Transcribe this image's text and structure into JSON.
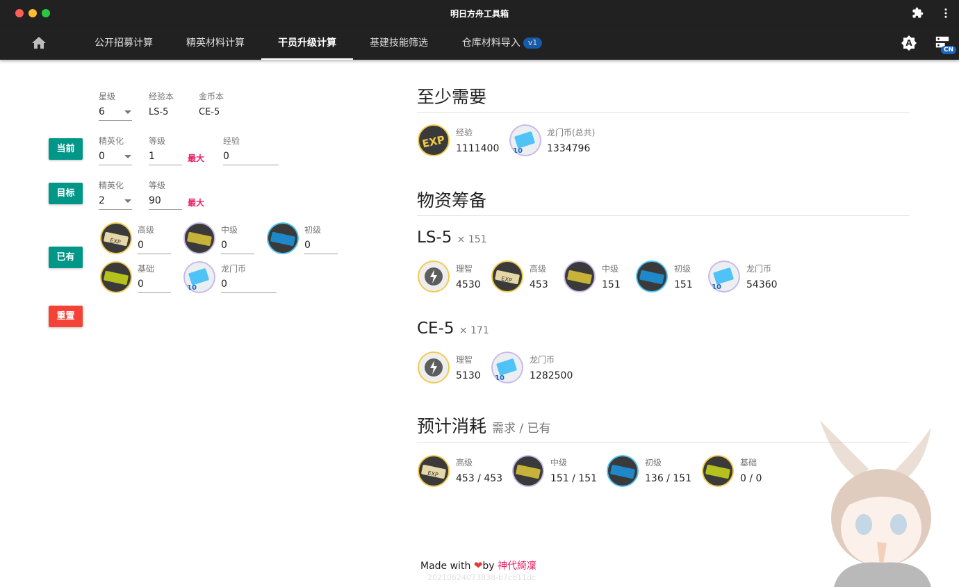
{
  "window": {
    "title": "明日方舟工具箱"
  },
  "nav": {
    "tabs": [
      {
        "label": "公开招募计算"
      },
      {
        "label": "精英材料计算"
      },
      {
        "label": "干员升级计算"
      },
      {
        "label": "基建技能筛选"
      },
      {
        "label": "仓库材料导入",
        "badge": "v1"
      }
    ],
    "active_tab": "干员升级计算",
    "lang_badge": "CN"
  },
  "form": {
    "header": {
      "star_label": "星级",
      "star_value": "6",
      "exp_book_label": "经验本",
      "exp_book_value": "LS-5",
      "gold_book_label": "金币本",
      "gold_book_value": "CE-5"
    },
    "current": {
      "button": "当前",
      "elite_label": "精英化",
      "elite_value": "0",
      "level_label": "等级",
      "level_value": "1",
      "max_label": "最大",
      "exp_label": "经验",
      "exp_value": "0"
    },
    "target": {
      "button": "目标",
      "elite_label": "精英化",
      "elite_value": "2",
      "level_label": "等级",
      "level_value": "90",
      "max_label": "最大"
    },
    "owned": {
      "button": "已有",
      "items": [
        {
          "label": "高级",
          "value": "0",
          "icon": "advanced-record-icon"
        },
        {
          "label": "中级",
          "value": "0",
          "icon": "intermediate-record-icon"
        },
        {
          "label": "初级",
          "value": "0",
          "icon": "basic-record-icon"
        },
        {
          "label": "基础",
          "value": "0",
          "icon": "drill-record-icon"
        },
        {
          "label": "龙门币",
          "value": "0",
          "icon": "lmd-icon"
        }
      ]
    },
    "reset_button": "重置"
  },
  "results": {
    "min_required": {
      "title": "至少需要",
      "items": [
        {
          "label": "经验",
          "value": "1111400",
          "icon": "exp-icon"
        },
        {
          "label": "龙门币(总共)",
          "value": "1334796",
          "icon": "lmd-icon"
        }
      ]
    },
    "prep": {
      "title": "物资筹备",
      "stages": [
        {
          "name": "LS-5",
          "mult": "× 151",
          "items": [
            {
              "label": "理智",
              "value": "4530",
              "icon": "sanity-icon"
            },
            {
              "label": "高级",
              "value": "453",
              "icon": "advanced-record-icon"
            },
            {
              "label": "中级",
              "value": "151",
              "icon": "intermediate-record-icon"
            },
            {
              "label": "初级",
              "value": "151",
              "icon": "basic-record-icon"
            },
            {
              "label": "龙门币",
              "value": "54360",
              "icon": "lmd-icon"
            }
          ]
        },
        {
          "name": "CE-5",
          "mult": "× 171",
          "items": [
            {
              "label": "理智",
              "value": "5130",
              "icon": "sanity-icon"
            },
            {
              "label": "龙门币",
              "value": "1282500",
              "icon": "lmd-icon"
            }
          ]
        }
      ]
    },
    "expected": {
      "title": "预计消耗",
      "subtitle": "需求 / 已有",
      "items": [
        {
          "label": "高级",
          "value": "453 / 453",
          "icon": "advanced-record-icon"
        },
        {
          "label": "中级",
          "value": "151 / 151",
          "icon": "intermediate-record-icon"
        },
        {
          "label": "初级",
          "value": "136 / 151",
          "icon": "basic-record-icon"
        },
        {
          "label": "基础",
          "value": "0 / 0",
          "icon": "drill-record-icon"
        }
      ]
    }
  },
  "footer": {
    "made_with": "Made with",
    "by": "by",
    "author": "神代綺凜",
    "build": "20210624073838-b7cb11dc"
  },
  "colors": {
    "nav_bg": "#212121",
    "teal": "#009688",
    "red": "#f44336",
    "pink": "#e91e63",
    "badge_blue": "#1565c0"
  }
}
